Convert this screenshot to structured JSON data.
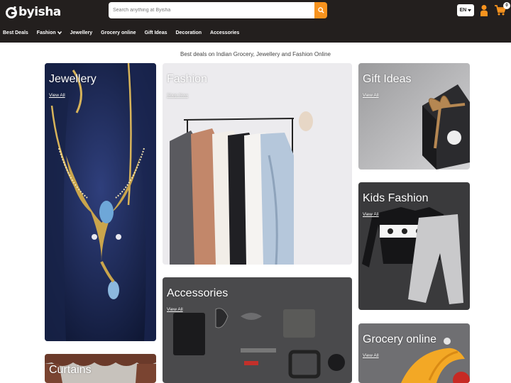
{
  "header": {
    "logo_text": "byisha",
    "search": {
      "placeholder": "Search anything at Byisha",
      "value": ""
    },
    "language": "EN",
    "cart_count": "0"
  },
  "nav": {
    "items": [
      {
        "label": "Best Deals"
      },
      {
        "label": "Fashion"
      },
      {
        "label": "Jewellery"
      },
      {
        "label": "Grocery online"
      },
      {
        "label": "Gift Ideas"
      },
      {
        "label": "Decoration"
      },
      {
        "label": "Accessories"
      }
    ]
  },
  "main": {
    "tagline": "Best deals on Indian Grocery, Jewellery and Fashion Online",
    "tiles": [
      {
        "title": "Jewellery",
        "link": "View All"
      },
      {
        "title": "Fashion",
        "link": "Shop Now"
      },
      {
        "title": "Gift Ideas",
        "link": "View All"
      },
      {
        "title": "Kids Fashion",
        "link": "View All"
      },
      {
        "title": "Accessories",
        "link": "View All"
      },
      {
        "title": "Grocery online",
        "link": "View All"
      },
      {
        "title": "Curtains",
        "link": ""
      }
    ]
  },
  "colors": {
    "header_bg": "#231f1e",
    "accent": "#f7931e"
  }
}
